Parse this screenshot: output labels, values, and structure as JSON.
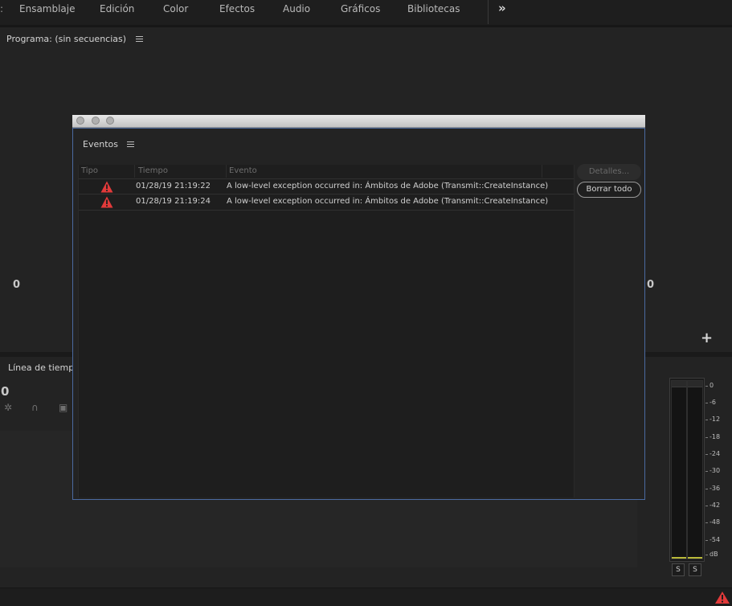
{
  "workspace": {
    "tabs": [
      "Ensamblaje",
      "Edición",
      "Color",
      "Efectos",
      "Audio",
      "Gráficos",
      "Bibliotecas"
    ],
    "more_label": "»"
  },
  "program": {
    "title": "Programa: (sin secuencias)",
    "timecode_left": "0",
    "timecode_right": "0",
    "add_label": "+"
  },
  "timeline": {
    "title": "Línea de tiempo",
    "timecode": "0"
  },
  "audio_meter": {
    "scale": [
      "0",
      "-6",
      "-12",
      "-18",
      "-24",
      "-30",
      "-36",
      "-42",
      "-48",
      "-54",
      "dB"
    ],
    "solo_labels": [
      "S",
      "S"
    ]
  },
  "events_dialog": {
    "title": "Eventos",
    "columns": [
      "Tipo",
      "Tiempo",
      "Evento"
    ],
    "rows": [
      {
        "type": "warning",
        "time": "01/28/19 21:19:22",
        "event": "A low-level exception occurred in: Ámbitos de Adobe (Transmit::CreateInstance)"
      },
      {
        "type": "warning",
        "time": "01/28/19 21:19:24",
        "event": "A low-level exception occurred in: Ámbitos de Adobe (Transmit::CreateInstance)"
      }
    ],
    "details_button": "Detalles...",
    "clear_button": "Borrar todo"
  },
  "colors": {
    "warning": "#e23a3a",
    "dialog_border": "#4b6aa0"
  }
}
